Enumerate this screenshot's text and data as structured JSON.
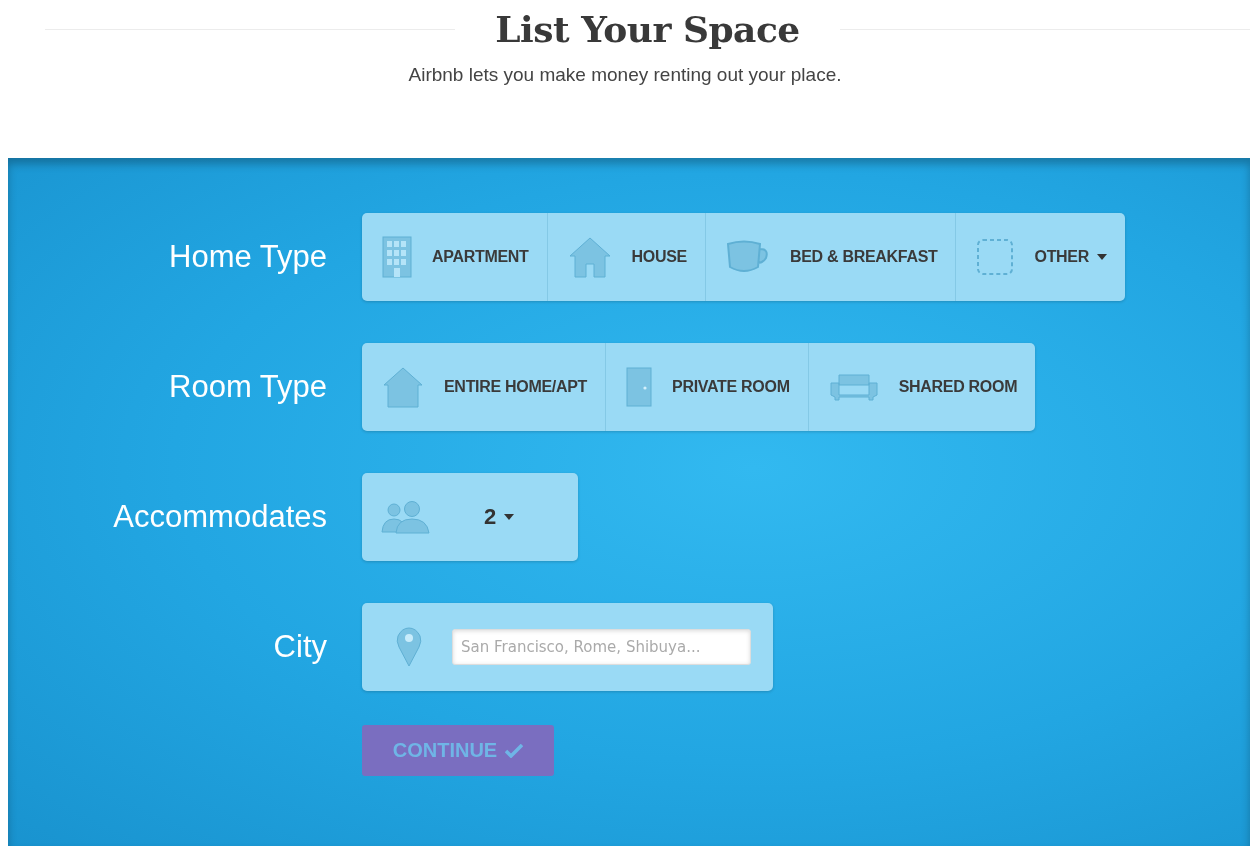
{
  "header": {
    "title": "List Your Space",
    "subtitle": "Airbnb lets you make money renting out your place."
  },
  "home_type": {
    "label": "Home Type",
    "options": [
      {
        "label": "APARTMENT",
        "dropdown": false
      },
      {
        "label": "HOUSE",
        "dropdown": false
      },
      {
        "label": "BED & BREAKFAST",
        "dropdown": false
      },
      {
        "label": "OTHER",
        "dropdown": true
      }
    ]
  },
  "room_type": {
    "label": "Room Type",
    "options": [
      {
        "label": "ENTIRE HOME/APT",
        "dropdown": false
      },
      {
        "label": "PRIVATE ROOM",
        "dropdown": false
      },
      {
        "label": "SHARED ROOM",
        "dropdown": false
      }
    ]
  },
  "accommodates": {
    "label": "Accommodates",
    "value": "2"
  },
  "city": {
    "label": "City",
    "placeholder": "San Francisco, Rome, Shibuya..."
  },
  "continue_button": {
    "label": "CONTINUE",
    "disabled": true
  }
}
